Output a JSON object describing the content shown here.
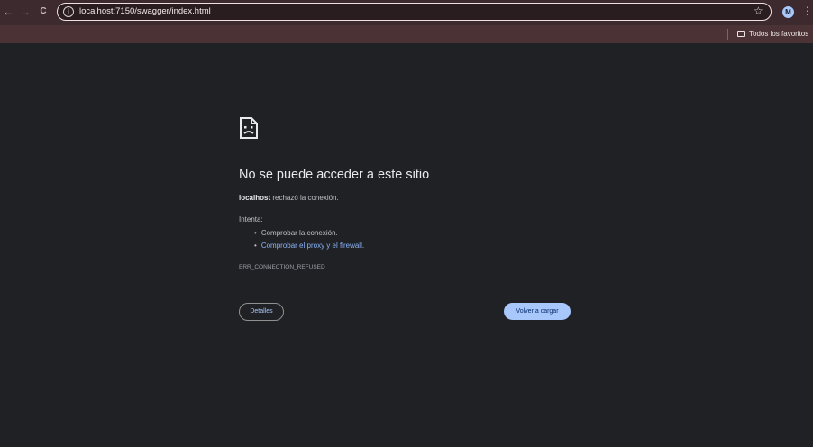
{
  "browser": {
    "url": "localhost:7150/swagger/index.html",
    "back_icon": "←",
    "forward_icon": "→",
    "reload_icon": "C",
    "info_icon": "i",
    "star_icon": "☆",
    "avatar_initial": "M",
    "menu_icon": "⋮",
    "bookmarks_folder": "Todos los favoritos"
  },
  "error_page": {
    "title": "No se puede acceder a este sitio",
    "host": "localhost",
    "message": " rechazó la conexión.",
    "try_label": "Intenta:",
    "suggestions": [
      "Comprobar la conexión.",
      "Comprobar el proxy y el firewall"
    ],
    "suggestion_tail": ".",
    "error_code": "ERR_CONNECTION_REFUSED",
    "details_button": "Detalles",
    "reload_button": "Volver a cargar"
  }
}
